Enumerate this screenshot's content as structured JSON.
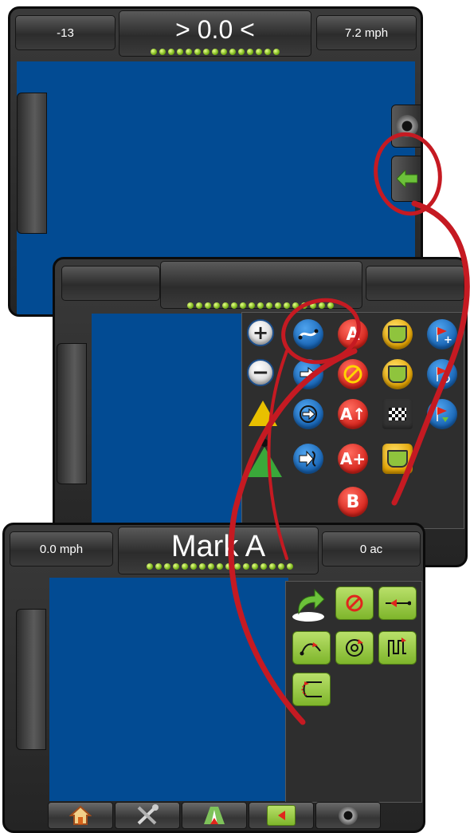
{
  "screen1": {
    "left_value": "-13",
    "center_value": "> 0.0 <",
    "right_value": "7.2 mph"
  },
  "screen3": {
    "left_value": "0.0 mph",
    "center_value": "Mark A",
    "right_value": "0 ac"
  },
  "guidance_menu": {
    "icons": [
      "zoom-in-icon",
      "guideline-mode-icon",
      "mark-a-icon",
      "boundary-icon",
      "add-flag-icon",
      "zoom-out-icon",
      "nudge-icon",
      "cancel-mark-icon",
      "cancel-boundary-icon",
      "cancel-flag-icon",
      "vehicle-view-icon",
      "recalc-icon",
      "mark-a-plus-icon",
      "checkered-flag-icon",
      "navigate-flag-icon",
      "overhead-view-icon",
      "guideline-next-icon",
      "mark-a-plus-plus-icon",
      "delete-boundary-icon",
      "mark-b-icon"
    ],
    "labels": {
      "mark_a": "A",
      "mark_b": "B",
      "a_up": "A↑",
      "a_plus": "A+"
    }
  },
  "guideline_menu": {
    "icons": [
      "return-to-point-icon",
      "no-guidance-icon",
      "straight-ab-icon",
      "curved-ab-icon",
      "circle-pivot-icon",
      "adaptive-curve-icon",
      "last-pass-icon"
    ]
  },
  "bottom_nav": {
    "items": [
      "home-icon",
      "tools-icon",
      "guidance-icon",
      "guidance-mode-icon",
      "camera-icon"
    ]
  },
  "colors": {
    "map_blue": "#024b93",
    "highlight_red": "#c51a22",
    "led_green": "#7bb51a",
    "arrow_green": "#6cc23a"
  }
}
